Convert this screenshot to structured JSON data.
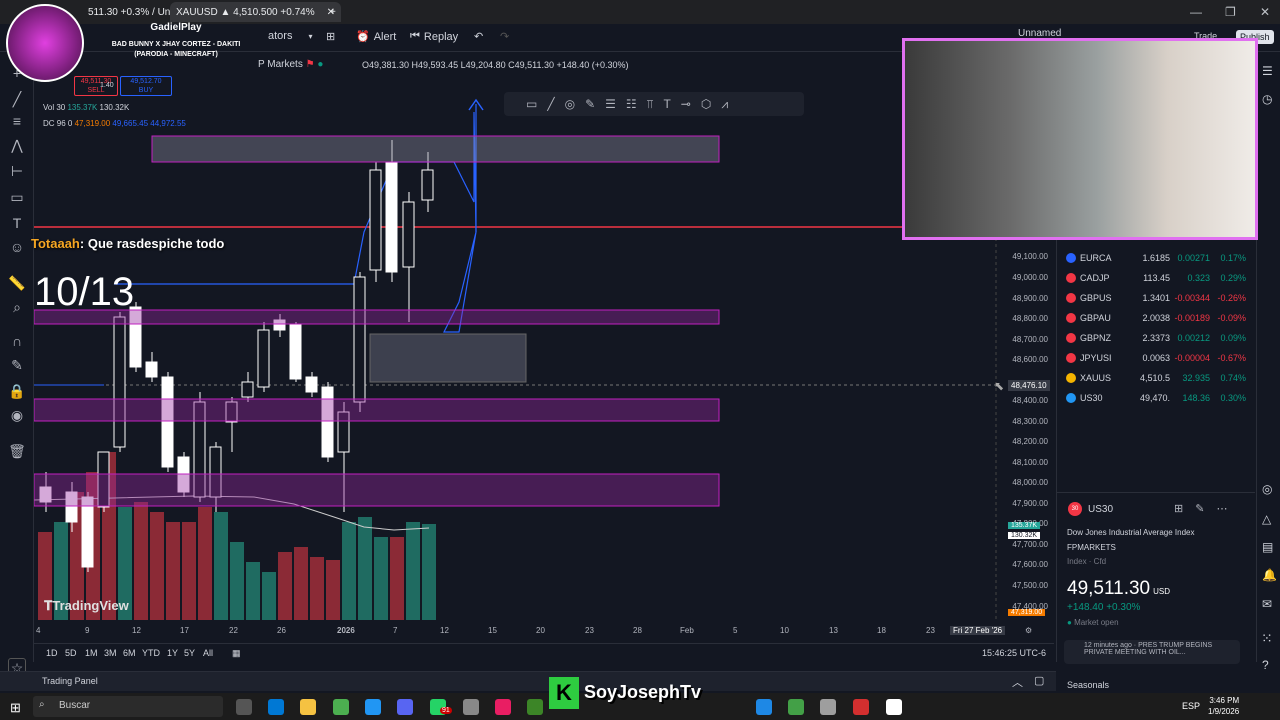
{
  "browser": {
    "tab1_text": "511.30 +0.3% / Un",
    "tab2_text": "XAUUSD ▲ 4,510.500 +0.74%",
    "new_tab": "+"
  },
  "toolbar": {
    "indicators": "ators",
    "alert": "Alert",
    "replay": "Replay",
    "unnamed": "Unnamed",
    "trade": "Trade",
    "publish": "Publish"
  },
  "symbol_line": {
    "exchange": "P Markets",
    "ohlc": "O49,381.30 H49,593.45 L49,204.80 C49,511.30 +148.40 (+0.30%)"
  },
  "trade_box": {
    "sell_price": "49,511.30",
    "sell_label": "SELL",
    "spread": "1.40",
    "buy_price": "49,512.70",
    "buy_label": "BUY"
  },
  "vol_line": {
    "label": "Vol 30",
    "v1": "135.37K",
    "v2": "130.32K"
  },
  "dc_line": {
    "label": "DC 96 0",
    "v1": "47,319.00",
    "v2": "49,665.45",
    "v3": "44,972.55"
  },
  "music": {
    "user": "GadielPlay",
    "song": "BAD BUNNY X JHAY CORTEZ - DAKITI",
    "sub": "(PARODIA - MINECRAFT)"
  },
  "chat": {
    "user": "Totaaah",
    "message": ": Que rasdespiche todo"
  },
  "counter": "10/13",
  "watermark": "TradingView",
  "price_axis": [
    "49,100.00",
    "49,000.00",
    "48,900.00",
    "48,800.00",
    "48,700.00",
    "48,600.00",
    "48,400.00",
    "48,300.00",
    "48,200.00",
    "48,100.00",
    "48,000.00",
    "47,900.00",
    "47,800.00",
    "47,700.00",
    "47,600.00",
    "47,500.00",
    "47,400.00"
  ],
  "crosshair_price": "48,476.10",
  "vol_badges": [
    "135.37K",
    "130.32K"
  ],
  "low_badge": "47,319.00",
  "date_axis": [
    "4",
    "9",
    "12",
    "17",
    "22",
    "26",
    "2026",
    "7",
    "12",
    "15",
    "20",
    "23",
    "28",
    "Feb",
    "5",
    "10",
    "13",
    "18",
    "23"
  ],
  "cursor_date": "Fri 27 Feb '26",
  "timeframes": [
    "1D",
    "5D",
    "1M",
    "3M",
    "6M",
    "YTD",
    "1Y",
    "5Y",
    "All"
  ],
  "clock": "15:46:25 UTC-6",
  "trading_panel": "Trading Panel",
  "watchlist": [
    {
      "sym": "EURCA",
      "last": "1.6185",
      "chg": "0.00271",
      "pct": "0.17%",
      "dir": "pos",
      "color": "#2962ff"
    },
    {
      "sym": "CADJP",
      "last": "113.45",
      "chg": "0.323",
      "pct": "0.29%",
      "dir": "pos",
      "color": "#f23645"
    },
    {
      "sym": "GBPUS",
      "last": "1.3401",
      "chg": "-0.00344",
      "pct": "-0.26%",
      "dir": "neg",
      "color": "#f23645"
    },
    {
      "sym": "GBPAU",
      "last": "2.0038",
      "chg": "-0.00189",
      "pct": "-0.09%",
      "dir": "neg",
      "color": "#f23645"
    },
    {
      "sym": "GBPNZ",
      "last": "2.3373",
      "chg": "0.00212",
      "pct": "0.09%",
      "dir": "pos",
      "color": "#f23645"
    },
    {
      "sym": "JPYUSI",
      "last": "0.0063",
      "chg": "-0.00004",
      "pct": "-0.67%",
      "dir": "neg",
      "color": "#f23645"
    },
    {
      "sym": "XAUUS",
      "last": "4,510.5",
      "chg": "32.935",
      "pct": "0.74%",
      "dir": "pos",
      "color": "#f5b400"
    },
    {
      "sym": "US30",
      "last": "49,470.",
      "chg": "148.36",
      "pct": "0.30%",
      "dir": "pos",
      "color": "#2196f3"
    }
  ],
  "details": {
    "symbol": "US30",
    "name": "Dow Jones Industrial Average Index",
    "broker": "FPMARKETS",
    "type": "Index · Cfd",
    "price_main": "49,51",
    "price_dec": "1.30",
    "currency": "USD",
    "change": "+148.40 +0.30%",
    "status": "Market open",
    "news_time": "12 minutes ago ·",
    "news_text": "PRES TRUMP BEGINS PRIVATE MEETING WITH OIL..."
  },
  "seasonals": "Seasonals",
  "taskbar": {
    "search": "Buscar",
    "lang": "ESP",
    "time": "3:46 PM",
    "date": "1/9/2026",
    "badge": "91"
  },
  "streamer": "SoyJosephTv"
}
